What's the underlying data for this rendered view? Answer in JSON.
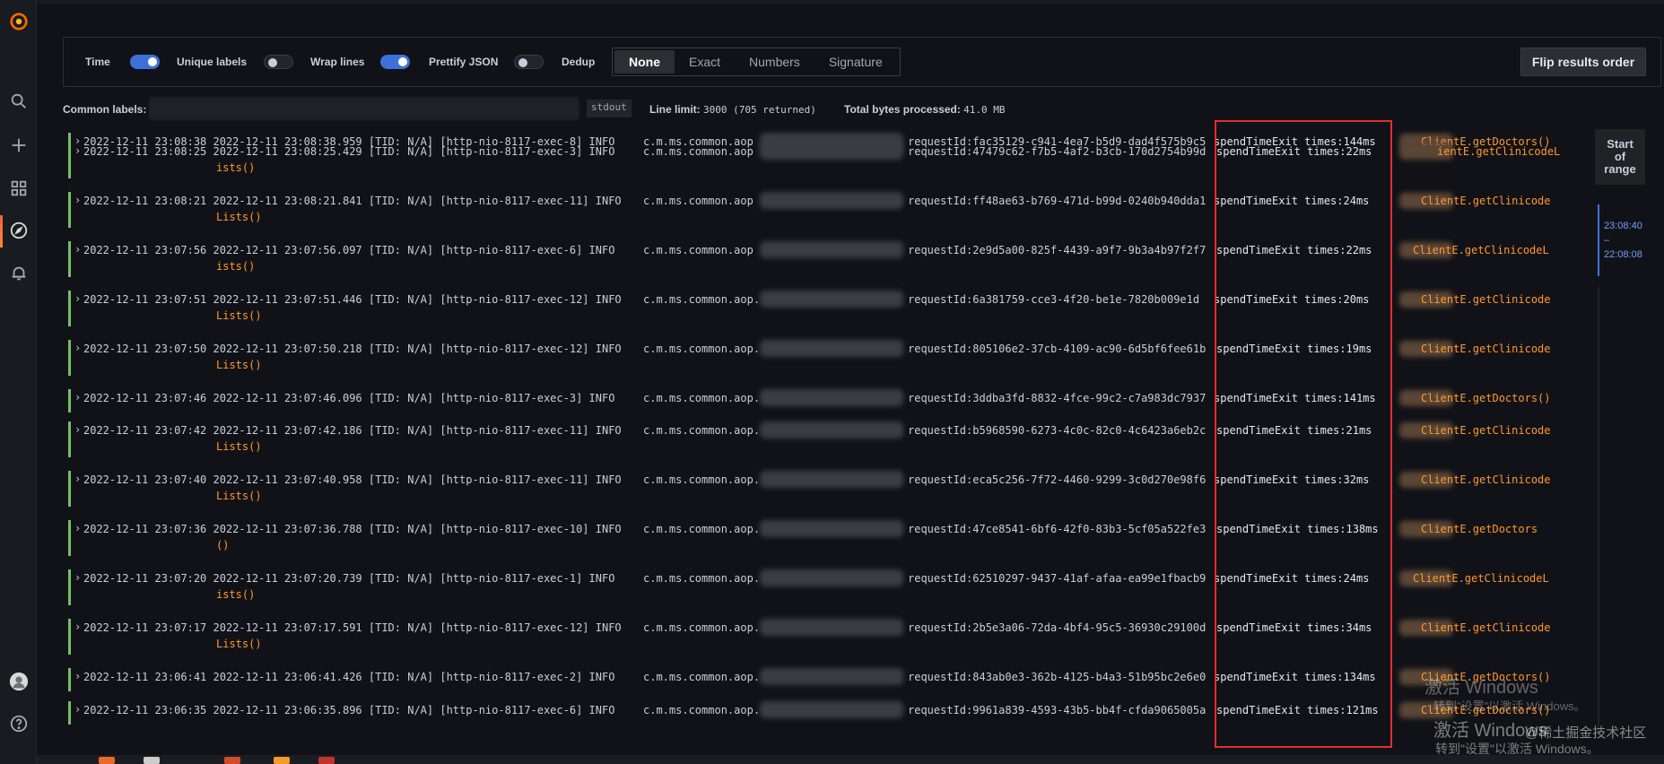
{
  "options": {
    "time_label": "Time",
    "unique_labels_label": "Unique labels",
    "wrap_lines_label": "Wrap lines",
    "prettify_json_label": "Prettify JSON",
    "dedup_label": "Dedup",
    "dedup_options": [
      "None",
      "Exact",
      "Numbers",
      "Signature"
    ],
    "dedup_selected": "None",
    "flip_label": "Flip results order"
  },
  "meta": {
    "common_labels": "Common labels:",
    "stdout": "stdout",
    "line_limit_label": "Line limit:",
    "line_limit_value": "3000 (705 returned)",
    "bytes_label": "Total bytes processed:",
    "bytes_value": "41.0 MB"
  },
  "logs": [
    {
      "ts": "2022-12-11 23:08:38",
      "log_ts": "2022-12-11 23:08:38.959",
      "thread": "[TID: N/A] [http-nio-8117-exec-8]",
      "level": "INFO",
      "pkg": "c.m.ms.common.aop",
      "req": "requestId:fac35129-c941-4ea7-b5d9-dad4f575b9c5",
      "spend": "spendTimeExit times:144ms",
      "client": "ClientE.getDoctors()",
      "cont": ""
    },
    {
      "ts": "2022-12-11 23:08:25",
      "log_ts": "2022-12-11 23:08:25.429",
      "thread": "[TID: N/A] [http-nio-8117-exec-3]",
      "level": "INFO",
      "pkg": "c.m.ms.common.aop",
      "req": "requestId:47479c62-f7b5-4af2-b3cb-170d2754b99d",
      "spend": "spendTimeExit times:22ms",
      "client": "ientE.getClinicodeL",
      "cont": "ists()"
    },
    {
      "ts": "2022-12-11 23:08:21",
      "log_ts": "2022-12-11 23:08:21.841",
      "thread": "[TID: N/A] [http-nio-8117-exec-11]",
      "level": "INFO",
      "pkg": "c.m.ms.common.aop",
      "req": "requestId:ff48ae63-b769-471d-b99d-0240b940dda1",
      "spend": "spendTimeExit times:24ms",
      "client": "ClientE.getClinicode",
      "cont": "Lists()"
    },
    {
      "ts": "2022-12-11 23:07:56",
      "log_ts": "2022-12-11 23:07:56.097",
      "thread": "[TID: N/A] [http-nio-8117-exec-6]",
      "level": "INFO",
      "pkg": "c.m.ms.common.aop",
      "req": "requestId:2e9d5a00-825f-4439-a9f7-9b3a4b97f2f7",
      "spend": "spendTimeExit times:22ms",
      "client": "ClientE.getClinicodeL",
      "cont": "ists()"
    },
    {
      "ts": "2022-12-11 23:07:51",
      "log_ts": "2022-12-11 23:07:51.446",
      "thread": "[TID: N/A] [http-nio-8117-exec-12]",
      "level": "INFO",
      "pkg": "c.m.ms.common.aop.",
      "req": "requestId:6a381759-cce3-4f20-be1e-7820b009e1d",
      "spend": "spendTimeExit times:20ms",
      "client": "ClientE.getClinicode",
      "cont": "Lists()"
    },
    {
      "ts": "2022-12-11 23:07:50",
      "log_ts": "2022-12-11 23:07:50.218",
      "thread": "[TID: N/A] [http-nio-8117-exec-12]",
      "level": "INFO",
      "pkg": "c.m.ms.common.aop.",
      "req": "requestId:805106e2-37cb-4109-ac90-6d5bf6fee61b",
      "spend": "spendTimeExit times:19ms",
      "client": "ClientE.getClinicode",
      "cont": "Lists()"
    },
    {
      "ts": "2022-12-11 23:07:46",
      "log_ts": "2022-12-11 23:07:46.096",
      "thread": "[TID: N/A] [http-nio-8117-exec-3]",
      "level": "INFO",
      "pkg": "c.m.ms.common.aop.",
      "req": "requestId:3ddba3fd-8832-4fce-99c2-c7a983dc7937",
      "spend": "spendTimeExit times:141ms",
      "client": "ClientE.getDoctors()",
      "cont": ""
    },
    {
      "ts": "2022-12-11 23:07:42",
      "log_ts": "2022-12-11 23:07:42.186",
      "thread": "[TID: N/A] [http-nio-8117-exec-11]",
      "level": "INFO",
      "pkg": "c.m.ms.common.aop.",
      "req": "requestId:b5968590-6273-4c0c-82c0-4c6423a6eb2c",
      "spend": "spendTimeExit times:21ms",
      "client": "ClientE.getClinicode",
      "cont": "Lists()"
    },
    {
      "ts": "2022-12-11 23:07:40",
      "log_ts": "2022-12-11 23:07:40.958",
      "thread": "[TID: N/A] [http-nio-8117-exec-11]",
      "level": "INFO",
      "pkg": "c.m.ms.common.aop.",
      "req": "requestId:eca5c256-7f72-4460-9299-3c0d270e98f6",
      "spend": "spendTimeExit times:32ms",
      "client": "ClientE.getClinicode",
      "cont": "Lists()"
    },
    {
      "ts": "2022-12-11 23:07:36",
      "log_ts": "2022-12-11 23:07:36.788",
      "thread": "[TID: N/A] [http-nio-8117-exec-10]",
      "level": "INFO",
      "pkg": "c.m.ms.common.aop.",
      "req": "requestId:47ce8541-6bf6-42f0-83b3-5cf05a522fe3",
      "spend": "spendTimeExit times:138ms",
      "client": "ClientE.getDoctors",
      "cont": "()"
    },
    {
      "ts": "2022-12-11 23:07:20",
      "log_ts": "2022-12-11 23:07:20.739",
      "thread": "[TID: N/A] [http-nio-8117-exec-1]",
      "level": "INFO",
      "pkg": "c.m.ms.common.aop.",
      "req": "requestId:62510297-9437-41af-afaa-ea99e1fbacb9",
      "spend": "spendTimeExit times:24ms",
      "client": "ClientE.getClinicodeL",
      "cont": "ists()"
    },
    {
      "ts": "2022-12-11 23:07:17",
      "log_ts": "2022-12-11 23:07:17.591",
      "thread": "[TID: N/A] [http-nio-8117-exec-12]",
      "level": "INFO",
      "pkg": "c.m.ms.common.aop.",
      "req": "requestId:2b5e3a06-72da-4bf4-95c5-36930c29100d",
      "spend": "spendTimeExit times:34ms",
      "client": "ClientE.getClinicode",
      "cont": "Lists()"
    },
    {
      "ts": "2022-12-11 23:06:41",
      "log_ts": "2022-12-11 23:06:41.426",
      "thread": "[TID: N/A] [http-nio-8117-exec-2]",
      "level": "INFO",
      "pkg": "c.m.ms.common.aop.",
      "req": "requestId:843ab0e3-362b-4125-b4a3-51b95bc2e6e0",
      "spend": "spendTimeExit times:134ms",
      "client": "ClientE.getDoctors()",
      "cont": ""
    },
    {
      "ts": "2022-12-11 23:06:35",
      "log_ts": "2022-12-11 23:06:35.896",
      "thread": "[TID: N/A] [http-nio-8117-exec-6]",
      "level": "INFO",
      "pkg": "c.m.ms.common.aop.",
      "req": "requestId:9961a839-4593-43b5-bb4f-cfda9065005a",
      "spend": "spendTimeExit times:121ms",
      "client": "ClientE.getDoctors()",
      "cont": ""
    }
  ],
  "range": {
    "start_label": "Start of range",
    "times": "23:08:40\n–\n22:08:08"
  },
  "watermark": {
    "line1": "激活 Windows",
    "line2": "转到\"设置\"以激活 Windows。",
    "line3": "激活 Windows",
    "community": "@稀土掘金技术社区",
    "line4": "转到\"设置\"以激活 Windows。"
  },
  "colors": {
    "accent": "#3d71d9",
    "log_bar": "#73bf69",
    "highlight": "#e02f2f",
    "method": "#ff9830"
  }
}
